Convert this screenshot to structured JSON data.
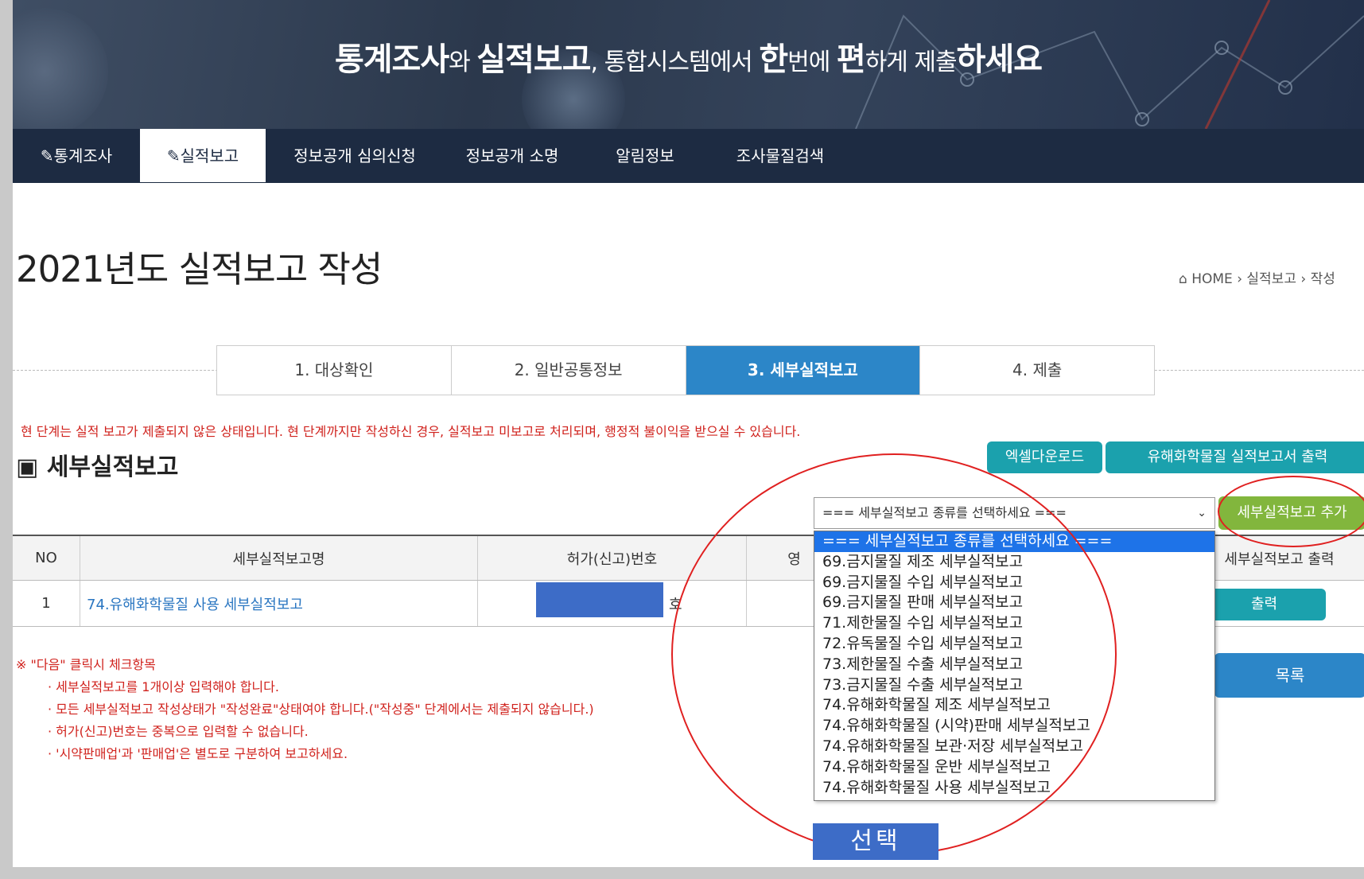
{
  "banner": {
    "parts": [
      {
        "text": "통계조사",
        "style": "b"
      },
      {
        "text": "와 ",
        "style": "s"
      },
      {
        "text": "실적보고",
        "style": "b"
      },
      {
        "text": ", 통합시스템에서 ",
        "style": "s"
      },
      {
        "text": "한",
        "style": "b"
      },
      {
        "text": "번에 ",
        "style": "s"
      },
      {
        "text": "편",
        "style": "b"
      },
      {
        "text": "하게 제출",
        "style": "s"
      },
      {
        "text": "하세요",
        "style": "b"
      }
    ]
  },
  "nav": [
    {
      "label": "통계조사",
      "icon": "edit-icon"
    },
    {
      "label": "실적보고",
      "icon": "edit-icon",
      "active": true
    },
    {
      "label": "정보공개 심의신청"
    },
    {
      "label": "정보공개 소명"
    },
    {
      "label": "알림정보"
    },
    {
      "label": "조사물질검색"
    }
  ],
  "page_title": "2021년도 실적보고 작성",
  "breadcrumb": {
    "home": "HOME",
    "level1": "실적보고",
    "level2": "작성"
  },
  "steps": [
    {
      "label": "1. 대상확인"
    },
    {
      "label": "2. 일반공통정보"
    },
    {
      "label": "3. 세부실적보고",
      "active": true
    },
    {
      "label": "4. 제출"
    }
  ],
  "warning": "현 단계는 실적 보고가 제출되지 않은 상태입니다. 현 단계까지만 작성하신 경우, 실적보고 미보고로 처리되며, 행정적 불이익을 받으실 수 있습니다.",
  "section_title": "세부실적보고",
  "buttons": {
    "excel": "엑셀다운로드",
    "print_report": "유해화학물질 실적보고서 출력",
    "add": "세부실적보고 추가",
    "row_print": "출력",
    "list": "목록"
  },
  "select": {
    "value": "=== 세부실적보고 종류를 선택하세요 ===",
    "options": [
      "=== 세부실적보고 종류를 선택하세요 ===",
      "69.금지물질 제조 세부실적보고",
      "69.금지물질 수입 세부실적보고",
      "69.금지물질 판매 세부실적보고",
      "71.제한물질 수입 세부실적보고",
      "72.유독물질 수입 세부실적보고",
      "73.제한물질 수출 세부실적보고",
      "73.금지물질 수출 세부실적보고",
      "74.유해화학물질 제조 세부실적보고",
      "74.유해화학물질 (시약)판매 세부실적보고",
      "74.유해화학물질 보관·저장 세부실적보고",
      "74.유해화학물질 운반 세부실적보고",
      "74.유해화학물질 사용 세부실적보고"
    ]
  },
  "table": {
    "headers": {
      "no": "NO",
      "name": "세부실적보고명",
      "permit": "허가(신고)번호",
      "col4": "영",
      "print": "세부실적보고 출력"
    },
    "rows": [
      {
        "no": "1",
        "name": "74.유해화학물질 사용 세부실적보고",
        "permit_suffix": "호"
      }
    ]
  },
  "notes": {
    "title": "※ \"다음\" 클릭시 체크항목",
    "items": [
      "· 세부실적보고를 1개이상 입력해야 합니다.",
      "· 모든 세부실적보고 작성상태가 \"작성완료\"상태여야 합니다.(\"작성중\" 단계에서는 제출되지 않습니다.)",
      "· 허가(신고)번호는 중복으로 입력할 수 없습니다.",
      "· '시약판매업'과 '판매업'은 별도로 구분하여 보고하세요."
    ]
  },
  "annotation_label": "선택",
  "colors": {
    "nav_bg": "#1d2b42",
    "step_active": "#2c86c8",
    "teal": "#1ba1ad",
    "green": "#82b63d",
    "warning": "#d0221d",
    "annotation": "#e02020"
  }
}
